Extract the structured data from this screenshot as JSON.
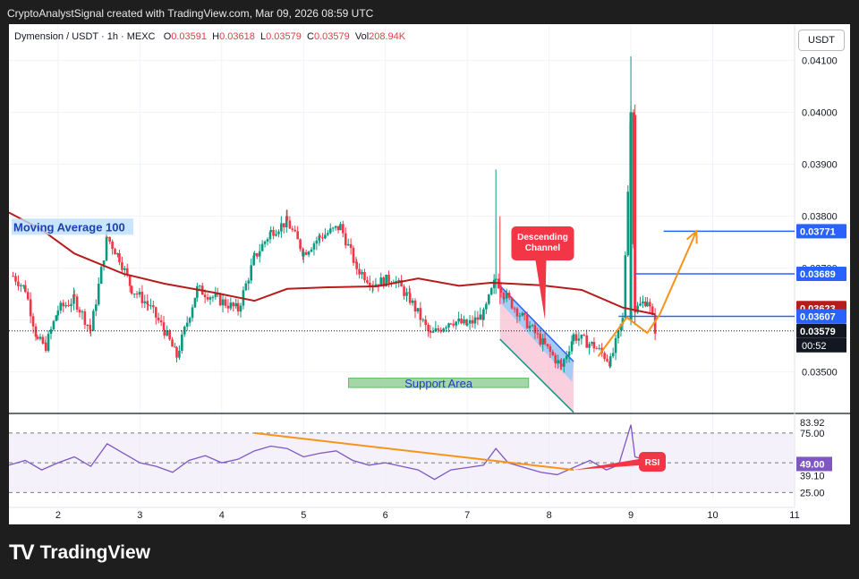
{
  "header": {
    "title": "CryptoAnalystSignal created with TradingView.com, Mar 09, 2026 08:59 UTC"
  },
  "legend": {
    "symbol": "Dymension / USDT · 1h · MEXC",
    "o_label": "O",
    "o": "0.03591",
    "h_label": "H",
    "h": "0.03618",
    "l_label": "L",
    "l": "0.03579",
    "c_label": "C",
    "c": "0.03579",
    "vol_label": "Vol",
    "vol": "208.94K"
  },
  "currency_button": "USDT",
  "footer": {
    "brand": "TradingView",
    "logo": "tradingview-logo"
  },
  "colors": {
    "up": "#089981",
    "down": "#f23645",
    "ma": "#b71c1c",
    "rsi": "#7e57c2",
    "blue": "#2962ff",
    "orange": "#f7931a",
    "support": "#66bb6a",
    "channel_fill": "#f8bbd0"
  },
  "chart_data": [
    {
      "type": "candlestick",
      "title": "Dymension / USDT · 1h · MEXC",
      "x_ticks": [
        "2",
        "3",
        "4",
        "5",
        "6",
        "7",
        "8",
        "9",
        "10",
        "11"
      ],
      "y_ticks": [
        "0.03500",
        "0.03600",
        "0.03700",
        "0.03800",
        "0.03900",
        "0.04000",
        "0.04100"
      ],
      "ylim": [
        0.0342,
        0.0417
      ],
      "xlim": [
        1.4,
        11.0
      ],
      "grid": true,
      "price_labels": [
        {
          "value": "0.03771",
          "color": "#2962ff"
        },
        {
          "value": "0.03689",
          "color": "#2962ff"
        },
        {
          "value": "0.03623",
          "color": "#b71c1c"
        },
        {
          "value": "0.03607",
          "color": "#2962ff"
        },
        {
          "value": "0.03579",
          "color": "#131722"
        }
      ],
      "countdown": "00:52",
      "series_ohlc_summary": [
        {
          "x": 1.45,
          "close": 0.03685
        },
        {
          "x": 1.6,
          "close": 0.0366
        },
        {
          "x": 1.75,
          "close": 0.0356
        },
        {
          "x": 1.85,
          "close": 0.0355
        },
        {
          "x": 2.0,
          "close": 0.0362
        },
        {
          "x": 2.2,
          "close": 0.0364
        },
        {
          "x": 2.4,
          "close": 0.0358
        },
        {
          "x": 2.6,
          "close": 0.0376
        },
        {
          "x": 2.75,
          "close": 0.0372
        },
        {
          "x": 2.9,
          "close": 0.0366
        },
        {
          "x": 3.1,
          "close": 0.0363
        },
        {
          "x": 3.3,
          "close": 0.0358
        },
        {
          "x": 3.45,
          "close": 0.0353
        },
        {
          "x": 3.7,
          "close": 0.0366
        },
        {
          "x": 3.95,
          "close": 0.0364
        },
        {
          "x": 4.2,
          "close": 0.0362
        },
        {
          "x": 4.4,
          "close": 0.0372
        },
        {
          "x": 4.6,
          "close": 0.0377
        },
        {
          "x": 4.8,
          "close": 0.0379
        },
        {
          "x": 5.0,
          "close": 0.0373
        },
        {
          "x": 5.2,
          "close": 0.0376
        },
        {
          "x": 5.45,
          "close": 0.0378
        },
        {
          "x": 5.65,
          "close": 0.037
        },
        {
          "x": 5.85,
          "close": 0.0367
        },
        {
          "x": 6.1,
          "close": 0.0368
        },
        {
          "x": 6.3,
          "close": 0.0364
        },
        {
          "x": 6.55,
          "close": 0.0357
        },
        {
          "x": 6.8,
          "close": 0.036
        },
        {
          "x": 7.0,
          "close": 0.0359
        },
        {
          "x": 7.2,
          "close": 0.0361
        },
        {
          "x": 7.35,
          "close": 0.0368
        },
        {
          "x": 7.45,
          "close": 0.0365
        },
        {
          "x": 7.7,
          "close": 0.036
        },
        {
          "x": 7.95,
          "close": 0.0355
        },
        {
          "x": 8.15,
          "close": 0.0351
        },
        {
          "x": 8.3,
          "close": 0.0357
        },
        {
          "x": 8.55,
          "close": 0.0355
        },
        {
          "x": 8.75,
          "close": 0.0352
        },
        {
          "x": 8.9,
          "close": 0.036
        },
        {
          "x": 9.0,
          "close": 0.04
        },
        {
          "x": 9.05,
          "close": 0.0362
        },
        {
          "x": 9.2,
          "close": 0.0364
        },
        {
          "x": 9.3,
          "close": 0.0358
        }
      ],
      "ma_series": {
        "name": "Moving Average 100",
        "points": [
          {
            "x": 1.4,
            "y": 0.03807
          },
          {
            "x": 1.8,
            "y": 0.03774
          },
          {
            "x": 2.2,
            "y": 0.03728
          },
          {
            "x": 2.8,
            "y": 0.03689
          },
          {
            "x": 3.3,
            "y": 0.0367
          },
          {
            "x": 3.9,
            "y": 0.03653
          },
          {
            "x": 4.4,
            "y": 0.03637
          },
          {
            "x": 4.8,
            "y": 0.0366
          },
          {
            "x": 5.3,
            "y": 0.03663
          },
          {
            "x": 5.9,
            "y": 0.03665
          },
          {
            "x": 6.4,
            "y": 0.0368
          },
          {
            "x": 6.9,
            "y": 0.03666
          },
          {
            "x": 7.3,
            "y": 0.03672
          },
          {
            "x": 7.9,
            "y": 0.03667
          },
          {
            "x": 8.4,
            "y": 0.03658
          },
          {
            "x": 8.9,
            "y": 0.03624
          },
          {
            "x": 9.3,
            "y": 0.03611
          }
        ]
      },
      "annotations": {
        "ma_label": "Moving Average 100",
        "support_label": "Support Area",
        "support_zone": {
          "x0": 5.55,
          "x1": 7.75,
          "y0": 0.0347,
          "y1": 0.03488
        },
        "channel_label_1": "Descending",
        "channel_label_2": "Channel",
        "channel": {
          "upper": [
            [
              7.4,
              0.03666
            ],
            [
              8.3,
              0.0352
            ]
          ],
          "lower": [
            [
              7.4,
              0.03563
            ],
            [
              8.3,
              0.03422
            ]
          ]
        },
        "h_levels": [
          {
            "y": 0.03771,
            "x0": 9.4,
            "x1": 11.0
          },
          {
            "y": 0.03689,
            "x0": 9.05,
            "x1": 11.0
          },
          {
            "y": 0.03607,
            "x0": 8.85,
            "x1": 11.0
          }
        ],
        "orange_path": [
          [
            8.6,
            0.0353
          ],
          [
            8.95,
            0.03605
          ],
          [
            9.2,
            0.03575
          ],
          [
            9.35,
            0.0361
          ],
          [
            9.8,
            0.03771
          ]
        ]
      }
    },
    {
      "type": "line",
      "indicator": "RSI",
      "label": "RSI",
      "ylim": [
        20,
        90
      ],
      "y_ticks": [
        "25.00",
        "39.10",
        "49.00",
        "75.00",
        "83.92"
      ],
      "bands": [
        25,
        75
      ],
      "midline": 50,
      "value_label": "49.00",
      "trendline": [
        [
          4.4,
          75
        ],
        [
          8.3,
          44
        ]
      ],
      "values": [
        {
          "x": 1.4,
          "y": 48
        },
        {
          "x": 1.6,
          "y": 52
        },
        {
          "x": 1.8,
          "y": 44
        },
        {
          "x": 2.0,
          "y": 50
        },
        {
          "x": 2.2,
          "y": 55
        },
        {
          "x": 2.4,
          "y": 47
        },
        {
          "x": 2.6,
          "y": 66
        },
        {
          "x": 2.8,
          "y": 58
        },
        {
          "x": 3.0,
          "y": 50
        },
        {
          "x": 3.2,
          "y": 47
        },
        {
          "x": 3.4,
          "y": 42
        },
        {
          "x": 3.6,
          "y": 52
        },
        {
          "x": 3.8,
          "y": 56
        },
        {
          "x": 4.0,
          "y": 50
        },
        {
          "x": 4.2,
          "y": 53
        },
        {
          "x": 4.4,
          "y": 60
        },
        {
          "x": 4.6,
          "y": 64
        },
        {
          "x": 4.8,
          "y": 62
        },
        {
          "x": 5.0,
          "y": 55
        },
        {
          "x": 5.2,
          "y": 58
        },
        {
          "x": 5.4,
          "y": 60
        },
        {
          "x": 5.6,
          "y": 52
        },
        {
          "x": 5.8,
          "y": 48
        },
        {
          "x": 6.0,
          "y": 50
        },
        {
          "x": 6.2,
          "y": 47
        },
        {
          "x": 6.4,
          "y": 44
        },
        {
          "x": 6.6,
          "y": 36
        },
        {
          "x": 6.8,
          "y": 44
        },
        {
          "x": 7.0,
          "y": 46
        },
        {
          "x": 7.2,
          "y": 48
        },
        {
          "x": 7.35,
          "y": 62
        },
        {
          "x": 7.5,
          "y": 50
        },
        {
          "x": 7.7,
          "y": 46
        },
        {
          "x": 7.9,
          "y": 42
        },
        {
          "x": 8.1,
          "y": 40
        },
        {
          "x": 8.3,
          "y": 46
        },
        {
          "x": 8.5,
          "y": 52
        },
        {
          "x": 8.7,
          "y": 44
        },
        {
          "x": 8.85,
          "y": 48
        },
        {
          "x": 9.0,
          "y": 82
        },
        {
          "x": 9.05,
          "y": 55
        },
        {
          "x": 9.2,
          "y": 52
        },
        {
          "x": 9.3,
          "y": 49
        }
      ]
    }
  ]
}
